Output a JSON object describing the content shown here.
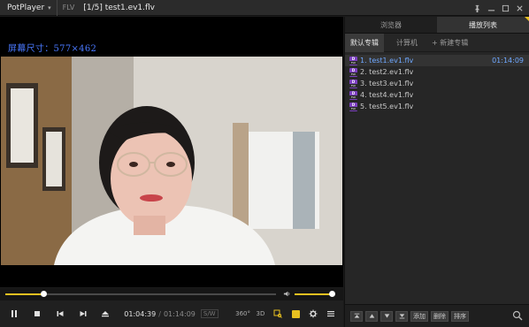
{
  "titlebar": {
    "app_name": "PotPlayer",
    "format": "FLV",
    "file_title": "[1/5] test1.ev1.flv"
  },
  "video": {
    "screen_info": "屏幕尺寸：577×462"
  },
  "playback": {
    "seek_progress": 0.14,
    "volume_level": 0.95,
    "current_time": "01:04:39",
    "separator": "/",
    "total_time": "01:14:09",
    "sw_label": "S/W",
    "mode_360": "360°",
    "mode_3d": "3D"
  },
  "panel": {
    "tabs": [
      {
        "label": "浏览器",
        "active": false
      },
      {
        "label": "播放列表",
        "active": true
      }
    ],
    "subtabs": [
      {
        "label": "默认专辑",
        "active": true
      },
      {
        "label": "计算机",
        "active": false
      },
      {
        "label": "+ 新建专辑",
        "active": false
      }
    ],
    "playlist": [
      {
        "label": "1. test1.ev1.flv",
        "duration": "01:14:09",
        "playing": true
      },
      {
        "label": "2. test2.ev1.flv",
        "duration": "",
        "playing": false
      },
      {
        "label": "3. test3.ev1.flv",
        "duration": "",
        "playing": false
      },
      {
        "label": "4. test4.ev1.flv",
        "duration": "",
        "playing": false
      },
      {
        "label": "5. test5.ev1.flv",
        "duration": "",
        "playing": false
      }
    ],
    "file_icon_top": "D",
    "file_icon_bottom": "FLV",
    "bottom_buttons": {
      "add": "添加",
      "delete": "删除",
      "sort": "排序"
    }
  },
  "colors": {
    "accent": "#e8c020",
    "playing_text": "#6fa8ff",
    "screen_info_text": "#4a79ff"
  }
}
